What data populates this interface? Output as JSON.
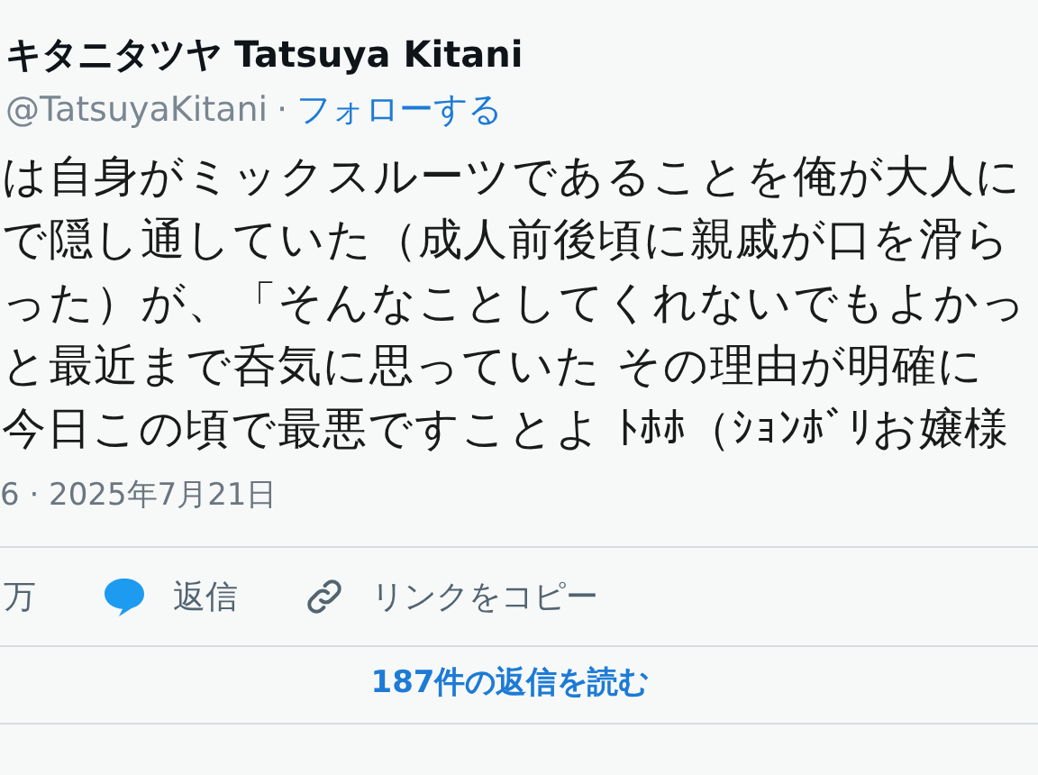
{
  "author": {
    "name": "キタニタツヤ Tatsuya Kitani",
    "handle": "@TatsuyaKitani",
    "separator": "·",
    "follow": "フォローする"
  },
  "body_lines": [
    "は自身がミックスルーツであることを俺が大人に",
    "で隠し通していた（成人前後頃に親戚が口を滑ら",
    "った）が、「そんなことしてくれないでもよかっ",
    "と最近まで呑気に思っていた その理由が明確に",
    "今日この頃で最悪ですことよ ﾄﾎﾎ（ｼｮﾝﾎﾞﾘお嬢様"
  ],
  "timestamp": "6 · 2025年7月21日",
  "actions": [
    {
      "kind": "count",
      "label": "万"
    },
    {
      "kind": "reply",
      "label": "返信"
    },
    {
      "kind": "link",
      "label": "リンクをコピー"
    }
  ],
  "read_replies": "187件の返信を読む"
}
